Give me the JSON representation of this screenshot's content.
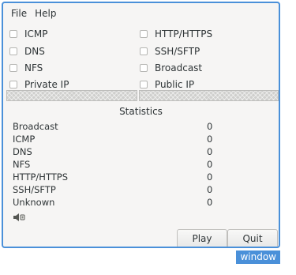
{
  "window": {
    "tag": "window",
    "accent": "#4a90d9"
  },
  "menu": [
    "File",
    "Help"
  ],
  "filters": {
    "left": [
      "ICMP",
      "DNS",
      "NFS",
      "Private IP"
    ],
    "right": [
      "HTTP/HTTPS",
      "SSH/SFTP",
      "Broadcast",
      "Public IP"
    ]
  },
  "statistics": {
    "title": "Statistics",
    "rows": [
      {
        "label": "Broadcast",
        "value": "0"
      },
      {
        "label": "ICMP",
        "value": "0"
      },
      {
        "label": "DNS",
        "value": "0"
      },
      {
        "label": "NFS",
        "value": "0"
      },
      {
        "label": "HTTP/HTTPS",
        "value": "0"
      },
      {
        "label": "SSH/SFTP",
        "value": "0"
      },
      {
        "label": "Unknown",
        "value": "0"
      }
    ]
  },
  "status_icon": "speaker-icon",
  "buttons": {
    "play": "Play",
    "quit": "Quit"
  }
}
